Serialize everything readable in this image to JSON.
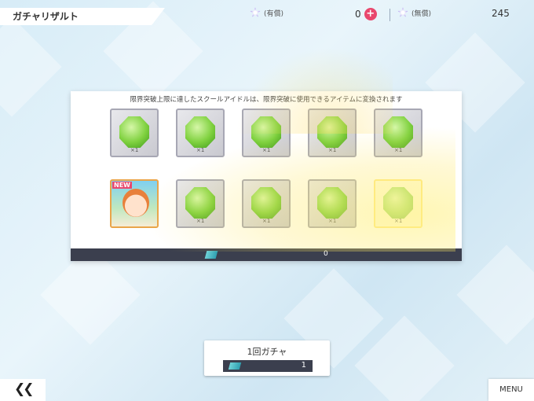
{
  "header": {
    "title": "ガチャリザルト",
    "paid_gem_label": "(有償)",
    "paid_gem_count": "0",
    "free_gem_label": "(無償)",
    "free_gem_count": "245"
  },
  "result_panel": {
    "notice": "限界突破上限に達したスクールアイドルは、限界突破に使用できるアイテムに変換されます",
    "new_badge": "NEW",
    "row1_qty": [
      "×1",
      "×1",
      "×1",
      "×1",
      "×1"
    ],
    "row2_qty": [
      "×1",
      "×1",
      "×1",
      "×1"
    ],
    "ticket_count": "0"
  },
  "gacha_button": {
    "label": "1回ガチャ",
    "cost": "1"
  },
  "nav": {
    "back_label": "❮❮",
    "menu_label": "MENU"
  },
  "colors": {
    "accent": "#e9476d",
    "bar": "#3b3f4e",
    "gem": "#7fd13f"
  }
}
